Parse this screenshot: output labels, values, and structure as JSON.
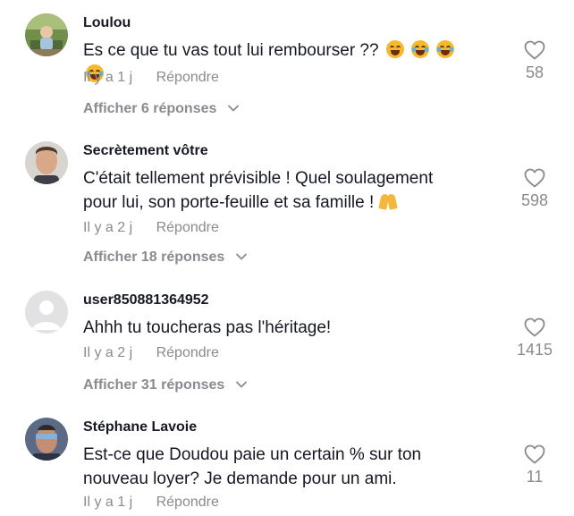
{
  "comments": [
    {
      "username": "Loulou",
      "text": "Es ce que tu vas tout lui rembourser ??",
      "time": "Il y a 1 j",
      "reply_label": "Répondre",
      "view_replies": "Afficher 6 réponses",
      "likes": "58",
      "avatar": "photo-avatar",
      "emoji": [
        "smiling-sweat-emoji",
        "tears-of-joy-emoji",
        "tears-of-joy-emoji",
        "tears-of-joy-emoji"
      ]
    },
    {
      "username": "Secrètement vôtre",
      "text": "C'était tellement prévisible ! Quel soulagement pour lui, son porte-feuille et sa famille !",
      "time": "Il y a 2 j",
      "reply_label": "Répondre",
      "view_replies": "Afficher 18 réponses",
      "likes": "598",
      "avatar": "photo-avatar",
      "emoji": [
        "folded-hands-emoji"
      ]
    },
    {
      "username": "user850881364952",
      "text": "Ahhh tu toucheras pas l'héritage!",
      "time": "Il y a 2 j",
      "reply_label": "Répondre",
      "view_replies": "Afficher 31 réponses",
      "likes": "1415",
      "avatar": "default-avatar"
    },
    {
      "username": "Stéphane Lavoie",
      "text": "Est-ce que Doudou paie un certain % sur ton nouveau loyer? Je demande pour un ami.",
      "time": "Il y a 1 j",
      "reply_label": "Répondre",
      "likes": "11",
      "avatar": "photo-avatar"
    }
  ],
  "icons": {
    "like": "heart-outline-icon",
    "expand": "chevron-down-icon"
  },
  "colors": {
    "text": "#161823",
    "secondary": "#8a8b91",
    "background": "#ffffff"
  }
}
